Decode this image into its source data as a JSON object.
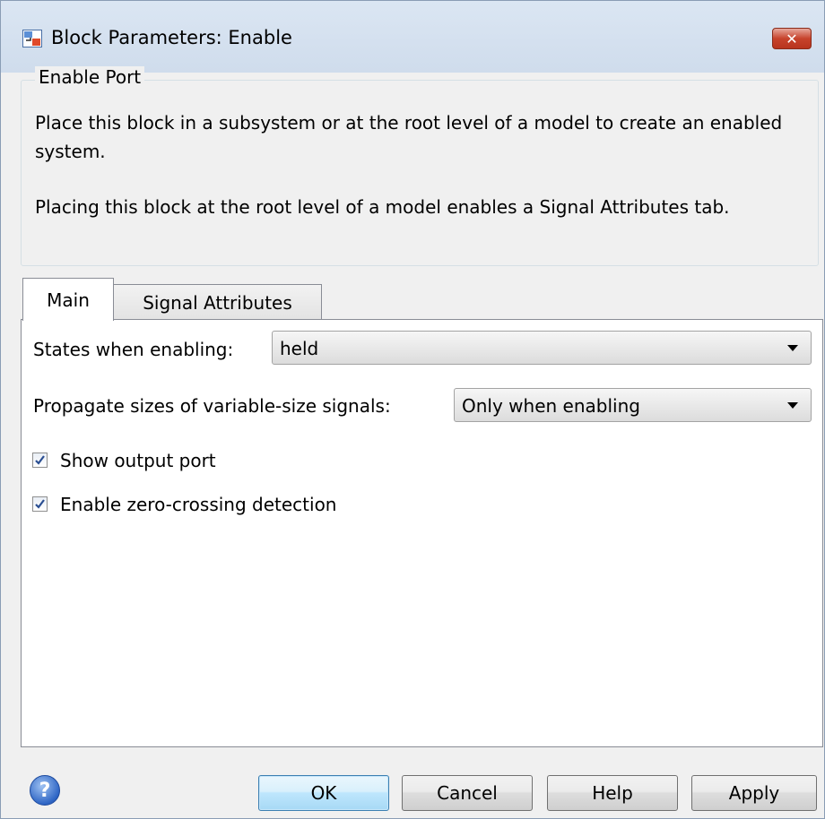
{
  "window": {
    "title": "Block Parameters: Enable",
    "close_glyph": "✕"
  },
  "group": {
    "legend": "Enable Port",
    "description_1": "Place this block in a subsystem or at the root level of a model to create an enabled system.",
    "description_2": "Placing this block at the root level of a model enables a Signal Attributes tab."
  },
  "tabs": [
    {
      "label": "Main",
      "selected": true
    },
    {
      "label": "Signal Attributes",
      "selected": false
    }
  ],
  "main": {
    "states_label": "States when enabling:",
    "states_value": "held",
    "propagate_label": "Propagate sizes of variable-size signals:",
    "propagate_value": "Only when enabling",
    "show_output_port": {
      "label": "Show output port",
      "checked": true
    },
    "zero_crossing": {
      "label": "Enable zero-crossing detection",
      "checked": true
    }
  },
  "footer": {
    "help_glyph": "?",
    "ok": "OK",
    "cancel": "Cancel",
    "help": "Help",
    "apply": "Apply"
  },
  "colors": {
    "titlebar": "#dbe6f3",
    "close_button": "#c7432c",
    "ok_highlight": "#3c7fb1"
  }
}
